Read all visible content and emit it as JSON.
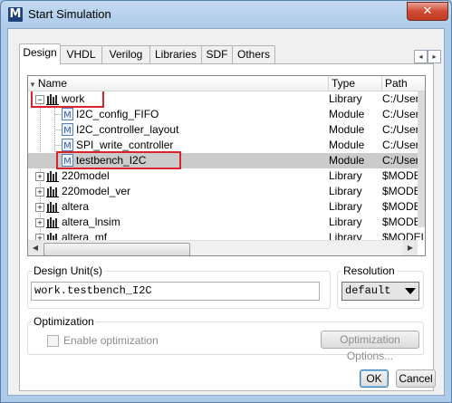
{
  "window": {
    "title": "Start Simulation",
    "app_icon": "M",
    "close_glyph": "✕"
  },
  "tabs": [
    {
      "label": "Design",
      "active": true
    },
    {
      "label": "VHDL",
      "active": false
    },
    {
      "label": "Verilog",
      "active": false
    },
    {
      "label": "Libraries",
      "active": false
    },
    {
      "label": "SDF",
      "active": false
    },
    {
      "label": "Others",
      "active": false
    }
  ],
  "tab_scroll": {
    "left": "◂",
    "right": "▸"
  },
  "list": {
    "sort_glyph": "▼",
    "columns": {
      "name": "Name",
      "type": "Type",
      "path": "Path"
    },
    "rows": [
      {
        "name": "work",
        "type": "Library",
        "path": "C:/User",
        "kind": "library",
        "expander": "−"
      },
      {
        "name": "I2C_config_FIFO",
        "type": "Module",
        "path": "C:/User",
        "kind": "module"
      },
      {
        "name": "I2C_controller_layout",
        "type": "Module",
        "path": "C:/User",
        "kind": "module"
      },
      {
        "name": "SPI_write_controller",
        "type": "Module",
        "path": "C:/User",
        "kind": "module"
      },
      {
        "name": "testbench_I2C",
        "type": "Module",
        "path": "C:/User",
        "kind": "module",
        "selected": true
      },
      {
        "name": "220model",
        "type": "Library",
        "path": "$MODEL",
        "kind": "library",
        "expander": "+"
      },
      {
        "name": "220model_ver",
        "type": "Library",
        "path": "$MODEL",
        "kind": "library",
        "expander": "+"
      },
      {
        "name": "altera",
        "type": "Library",
        "path": "$MODEL",
        "kind": "library",
        "expander": "+"
      },
      {
        "name": "altera_lnsim",
        "type": "Library",
        "path": "$MODEL",
        "kind": "library",
        "expander": "+"
      },
      {
        "name": "altera_mf",
        "type": "Library",
        "path": "$MODEL",
        "kind": "library",
        "expander": "+"
      }
    ]
  },
  "scrollbar_glyphs": {
    "left": "◀",
    "right": "▶"
  },
  "design_unit": {
    "label": "Design Unit(s)",
    "value": "work.testbench_I2C"
  },
  "resolution": {
    "label": "Resolution",
    "value": "default"
  },
  "optimization": {
    "label": "Optimization",
    "checkbox_label": "Enable optimization",
    "options_button": "Optimization Options..."
  },
  "buttons": {
    "ok": "OK",
    "cancel": "Cancel"
  },
  "colors": {
    "highlight_box": "#d9232d",
    "selection": "#cbcbcb"
  }
}
